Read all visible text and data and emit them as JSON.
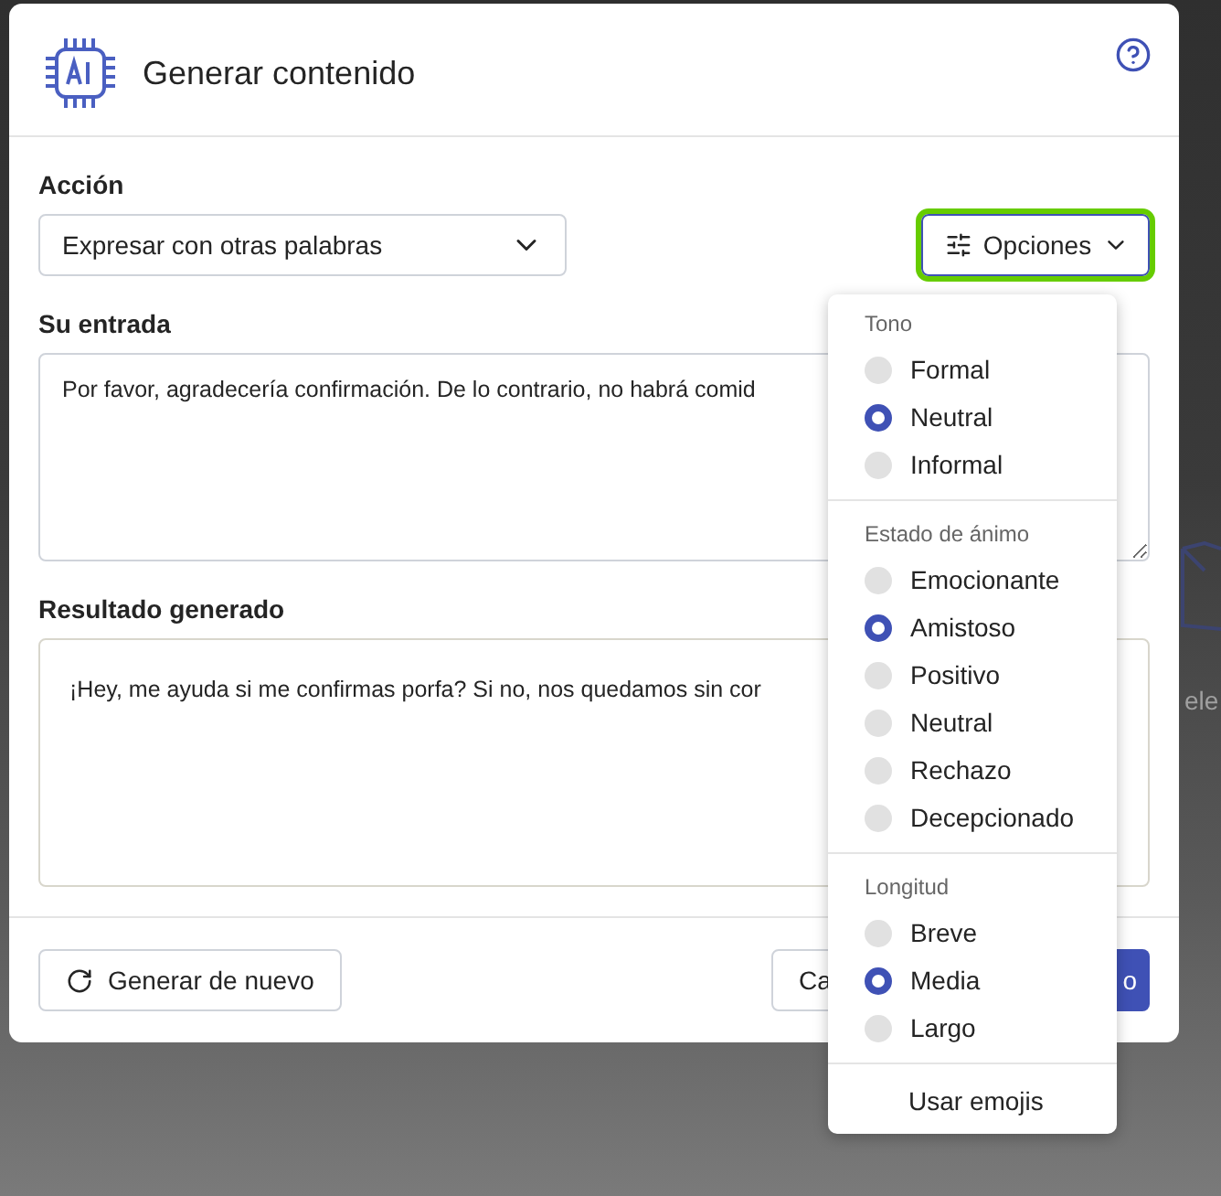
{
  "dialog": {
    "title": "Generar contenido",
    "action": {
      "label": "Acción",
      "value": "Expresar con otras palabras"
    },
    "options_button": {
      "label": "Opciones",
      "highlighted": true
    },
    "input": {
      "label": "Su entrada",
      "value": "Por favor, agradecería confirmación. De lo contrario, no habrá comid"
    },
    "result": {
      "label": "Resultado generado",
      "value": "¡Hey, me ayuda si me confirmas porfa? Si no, nos quedamos sin cor"
    },
    "footer": {
      "regenerate": "Generar de nuevo",
      "cancel": "Ca",
      "primary": "o"
    }
  },
  "options_menu": {
    "groups": [
      {
        "title": "Tono",
        "options": [
          {
            "label": "Formal",
            "selected": false
          },
          {
            "label": "Neutral",
            "selected": true
          },
          {
            "label": "Informal",
            "selected": false
          }
        ]
      },
      {
        "title": "Estado de ánimo",
        "options": [
          {
            "label": "Emocionante",
            "selected": false
          },
          {
            "label": "Amistoso",
            "selected": true
          },
          {
            "label": "Positivo",
            "selected": false
          },
          {
            "label": "Neutral",
            "selected": false
          },
          {
            "label": "Rechazo",
            "selected": false
          },
          {
            "label": "Decepcionado",
            "selected": false
          }
        ]
      },
      {
        "title": "Longitud",
        "options": [
          {
            "label": "Breve",
            "selected": false
          },
          {
            "label": "Media",
            "selected": true
          },
          {
            "label": "Largo",
            "selected": false
          }
        ]
      }
    ],
    "emoji_option": "Usar emojis"
  },
  "background": {
    "text": "ele"
  }
}
